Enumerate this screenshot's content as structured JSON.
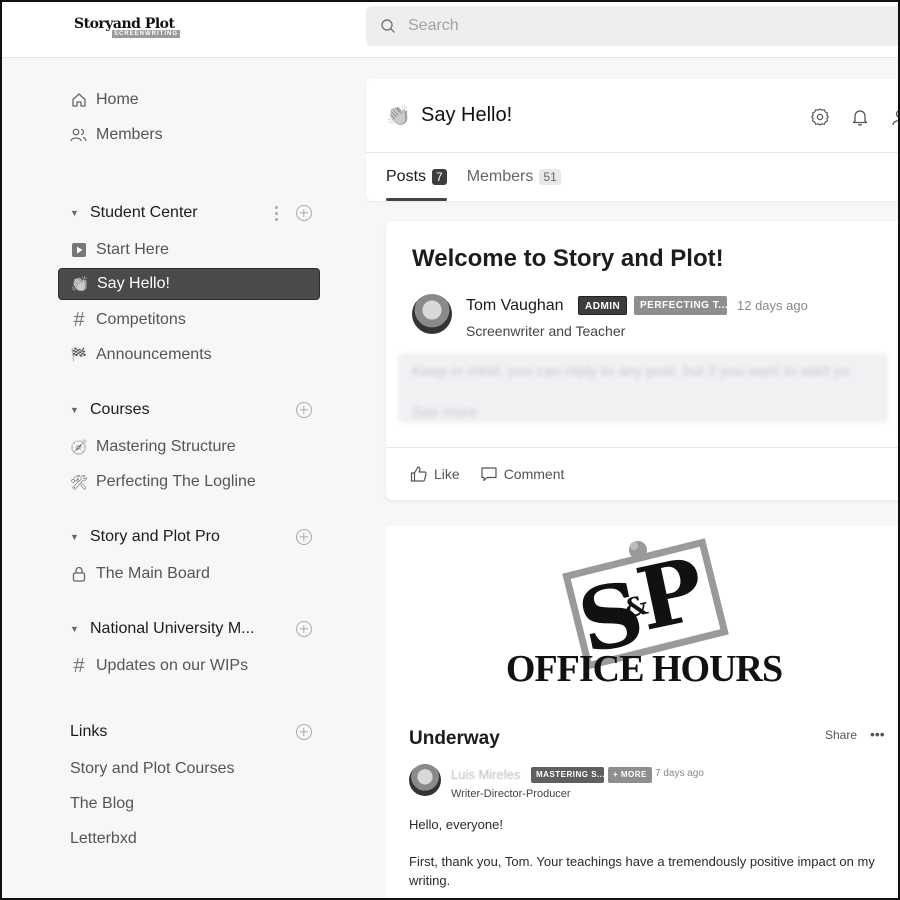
{
  "brand": {
    "logo_main": "Storyand Plot",
    "logo_sub": "SCREENWRITING"
  },
  "search": {
    "placeholder": "Search",
    "value": ""
  },
  "sidebar": {
    "top_items": [
      {
        "label": "Home",
        "icon": "home-icon"
      },
      {
        "label": "Members",
        "icon": "members-icon"
      }
    ],
    "sections": [
      {
        "label": "Student Center",
        "items": [
          {
            "label": "Start Here",
            "icon": "play-button-icon",
            "glyph": "▶"
          },
          {
            "label": "Say Hello!",
            "icon": "clapping-hands-icon",
            "glyph": "👏",
            "active": true
          },
          {
            "label": "Competitons",
            "icon": "hash-icon",
            "glyph": "#"
          },
          {
            "label": "Announcements",
            "icon": "flags-icon",
            "glyph": "🏁"
          }
        ]
      },
      {
        "label": "Courses",
        "items": [
          {
            "label": "Mastering Structure",
            "icon": "compass-icon",
            "glyph": "🧭"
          },
          {
            "label": "Perfecting The Logline",
            "icon": "tools-icon",
            "glyph": "🛠"
          }
        ]
      },
      {
        "label": "Story and Plot Pro",
        "items": [
          {
            "label": "The Main Board",
            "icon": "lock-icon",
            "glyph": "🔒"
          }
        ]
      },
      {
        "label": "National University M...",
        "items": [
          {
            "label": "Updates on our WIPs",
            "icon": "hash-icon",
            "glyph": "#"
          }
        ]
      }
    ],
    "links": {
      "label": "Links",
      "items": [
        "Story and Plot Courses",
        "The Blog",
        "Letterbxd"
      ]
    }
  },
  "channel": {
    "emoji": "👏",
    "title": "Say Hello!",
    "tabs": [
      {
        "label": "Posts",
        "count": "7",
        "active": true
      },
      {
        "label": "Members",
        "count": "51",
        "active": false
      }
    ]
  },
  "pinned_post": {
    "title": "Welcome to Story and Plot!",
    "author": "Tom Vaughan",
    "badges": [
      {
        "label": "ADMIN",
        "color": "#3d3d3d"
      },
      {
        "label": "PERFECTING T...",
        "color": "#8e8e8e"
      }
    ],
    "time_ago": "12 days ago",
    "bio": "Screenwriter and Teacher",
    "body_preview": "Keep in mind, you can reply to any post, but if you want to start yo",
    "see_more": "See more",
    "actions": {
      "like": "Like",
      "comment": "Comment"
    }
  },
  "feed_post": {
    "image_text": {
      "monogram_s": "S",
      "monogram_amp": "&",
      "monogram_p": "P",
      "caption": "OFFICE HOURS"
    },
    "title": "Underway",
    "share": "Share",
    "more": "•••",
    "author": "Luis Mireles",
    "badges": [
      {
        "label": "MASTERING S...",
        "color": "#5f5f5f"
      },
      {
        "label": "+ MORE",
        "color": "#8e8e8e"
      }
    ],
    "time_ago": "7 days ago",
    "bio": "Writer-Director-Producer",
    "body": [
      "Hello, everyone!",
      "First, thank you, Tom. Your teachings have a tremendously positive impact on my writing."
    ]
  }
}
